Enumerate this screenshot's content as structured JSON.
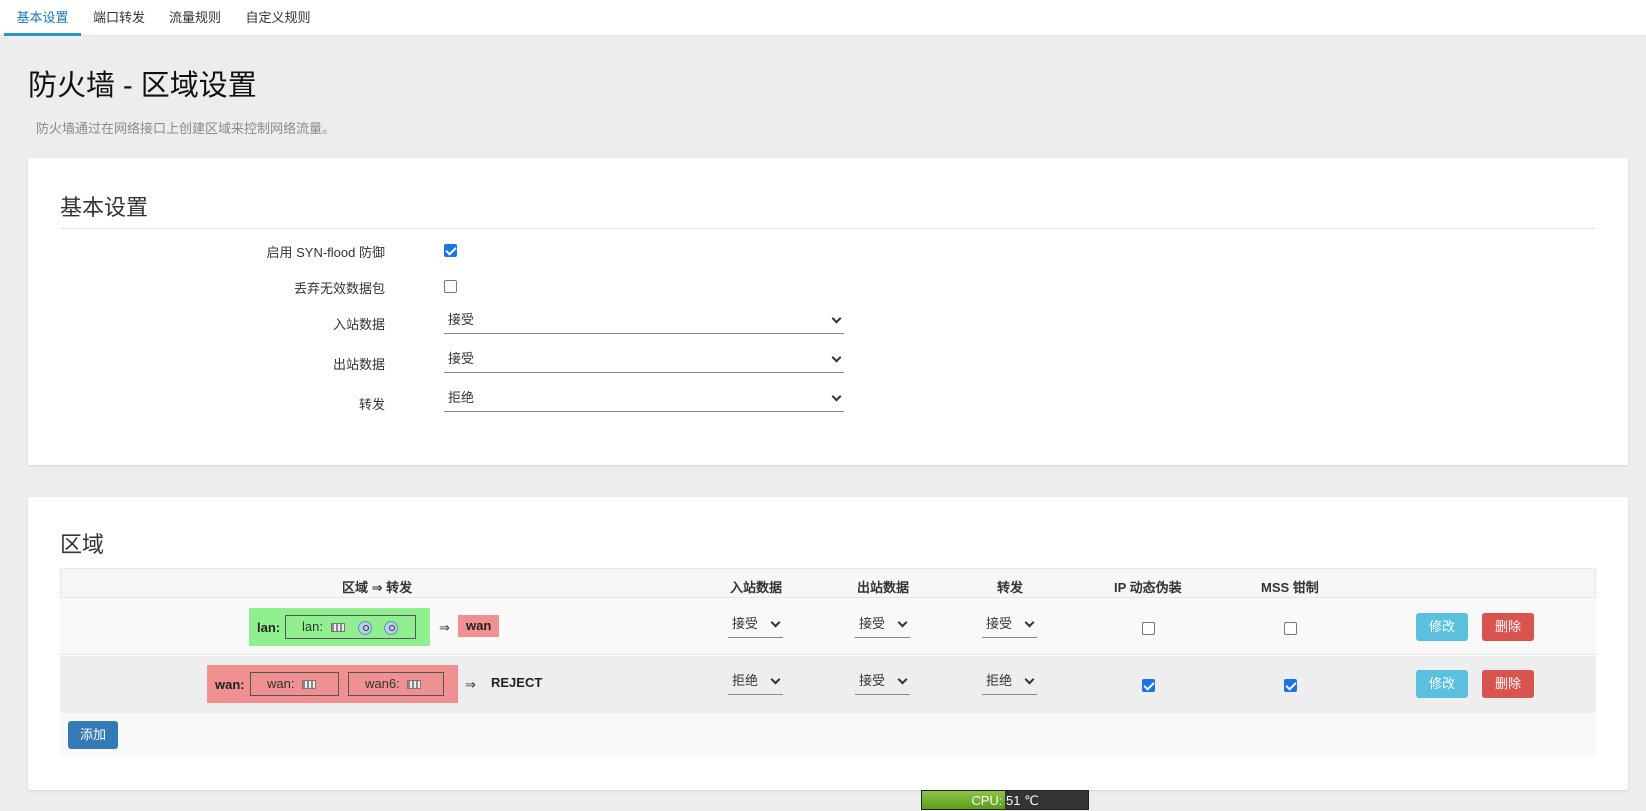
{
  "tabs": [
    {
      "label": "基本设置",
      "active": true
    },
    {
      "label": "端口转发",
      "active": false
    },
    {
      "label": "流量规则",
      "active": false
    },
    {
      "label": "自定义规则",
      "active": false
    }
  ],
  "page": {
    "title": "防火墙 - 区域设置",
    "description": "防火墙通过在网络接口上创建区域来控制网络流量。"
  },
  "general": {
    "title": "基本设置",
    "syn_flood_label": "启用 SYN-flood 防御",
    "syn_flood_checked": true,
    "drop_invalid_label": "丢弃无效数据包",
    "drop_invalid_checked": false,
    "input_label": "入站数据",
    "input_value": "接受",
    "output_label": "出站数据",
    "output_value": "接受",
    "forward_label": "转发",
    "forward_value": "拒绝"
  },
  "zones": {
    "title": "区域",
    "columns": {
      "zone_forward": "区域 ⇒ 转发",
      "input": "入站数据",
      "output": "出站数据",
      "forward": "转发",
      "masq": "IP 动态伪装",
      "mss": "MSS 钳制"
    },
    "rows": [
      {
        "zone": "lan:",
        "zone_color": "#90f090",
        "interfaces": [
          {
            "label": "lan:"
          }
        ],
        "arrow": "⇒",
        "dest": "wan",
        "dest_color": "#f09090",
        "input": "接受",
        "output": "接受",
        "forward": "接受",
        "masq": false,
        "mss": false
      },
      {
        "zone": "wan:",
        "zone_color": "#f09090",
        "interfaces": [
          {
            "label": "wan:"
          },
          {
            "label": "wan6:"
          }
        ],
        "arrow": "⇒",
        "dest": "REJECT",
        "dest_color": "",
        "input": "拒绝",
        "output": "接受",
        "forward": "拒绝",
        "masq": true,
        "mss": true
      }
    ],
    "edit_label": "修改",
    "delete_label": "删除",
    "add_label": "添加"
  },
  "status": {
    "cpu_text": "CPU: 51 ℃",
    "cpu_fill_fraction": 0.5
  },
  "colors": {
    "accent": "#2996c8",
    "edit": "#5bc0de",
    "delete": "#d9534f",
    "add": "#337ab7"
  }
}
